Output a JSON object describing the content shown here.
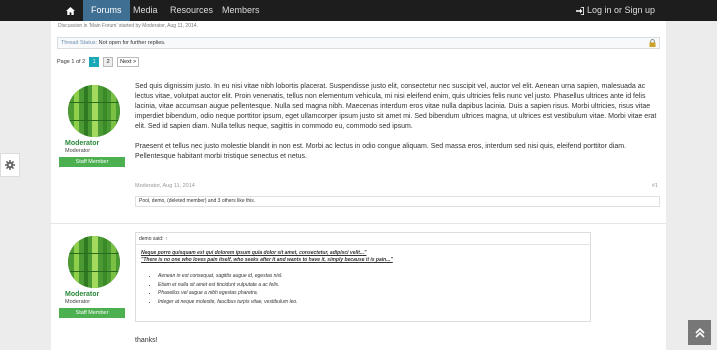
{
  "nav": {
    "home_icon": "home-icon",
    "items": [
      {
        "label": "Forums",
        "active": true
      },
      {
        "label": "Media",
        "active": false
      },
      {
        "label": "Resources",
        "active": false
      },
      {
        "label": "Members",
        "active": false
      }
    ],
    "login_label": "Log in or Sign up",
    "login_icon": "sign-in-icon"
  },
  "thread": {
    "discussion_line": "Discussion in 'Main Forum' started by Moderator, Aug 11, 2014.",
    "status_label": "Thread Status:",
    "status_value": "Not open for further replies.",
    "lock_icon": "lock-icon"
  },
  "pager": {
    "page_text": "Page 1 of 2",
    "pages": [
      "1",
      "2"
    ],
    "current": "1",
    "next_label": "Next >"
  },
  "posts": [
    {
      "author": "Moderator",
      "user_title": "Moderator",
      "badge": "Staff Member",
      "paragraphs": [
        "Sed quis dignissim justo. In eu nisi vitae nibh lobortis placerat. Suspendisse justo elit, consectetur nec suscipit vel, auctor vel elit. Aenean urna sapien, malesuada ac lectus vitae, volutpat auctor elit. Proin venenatis, tellus non elementum vehicula, mi nisi eleifend enim, quis ultricies felis nunc vel justo. Phasellus ultrices ante id felis lacinia, vitae accumsan augue pellentesque. Nulla sed magna nibh. Maecenas interdum eros vitae nulla dapibus lacinia. Duis a sapien risus. Morbi ultricies, risus vitae imperdiet bibendum, odio neque porttitor ipsum, eget ullamcorper ipsum justo sit amet mi. Sed bibendum ultrices magna, ut ultrices est vestibulum vitae. Morbi vitae erat elit. Sed id sapien diam. Nulla tellus neque, sagittis in commodo eu, commodo sed ipsum.",
        "Praesent et tellus nec justo molestie blandit in non est. Morbi ac lectus in odio congue aliquam. Sed massa eros, interdum sed nisi quis, eleifend porttitor diam. Pellentesque habitant morbi tristique senectus et netus."
      ],
      "meta_author": "Moderator, Aug 11, 2014",
      "post_number": "#1",
      "likes": "Pool, demo, (deleted member) and 3 others like this."
    },
    {
      "author": "Moderator",
      "user_title": "Moderator",
      "badge": "Staff Member",
      "quote_header": "demo said: ↑",
      "quote_lines": [
        "Neque porro quisquam est qui dolorem ipsum quia dolor sit amet, consectetur, adipisci velit...\"",
        "\"There is no one who loves pain itself, who seeks after it and wants to have it, simply because it is pain...\""
      ],
      "quote_list": [
        "Aenean in est consequat, sagittis augue id, egestas nisl.",
        "Etiam et nulla sit amet est tincidunt vulputate a ac felis.",
        "Phasellus vel augue a nibh egestas pharetra.",
        "Integer at neque molestie, faucibus turpis vitae, vestibulum leo."
      ],
      "reply": "thanks!"
    }
  ],
  "colors": {
    "nav_bg": "#1d1d1d",
    "nav_active": "#3f6f92",
    "username": "#2a8a3a",
    "badge": "#4caf50",
    "page_current": "#19a8b8"
  },
  "side_gear_icon": "gear-icon",
  "scroll_top_icon": "double-chevron-up-icon"
}
